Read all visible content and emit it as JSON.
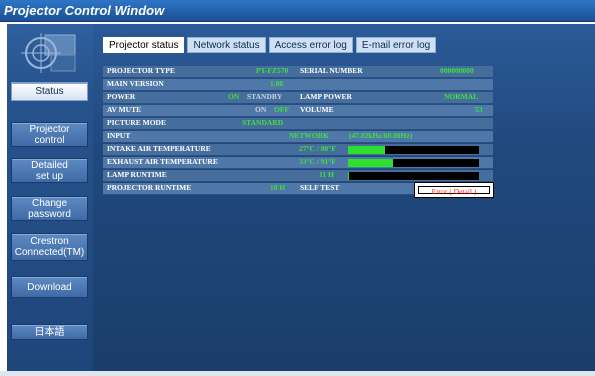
{
  "window": {
    "title": "Projector Control Window"
  },
  "nav": [
    {
      "label": "Status",
      "active": true
    },
    {
      "label": "Projector\ncontrol",
      "active": false
    },
    {
      "label": "Detailed\nset up",
      "active": false
    },
    {
      "label": "Change\npassword",
      "active": false
    },
    {
      "label": "Crestron\nConnected(TM)",
      "active": false
    },
    {
      "label": "Download",
      "active": false
    },
    {
      "label": "日本語",
      "active": false
    }
  ],
  "tabs": [
    {
      "label": "Projector status",
      "active": true
    },
    {
      "label": "Network status",
      "active": false
    },
    {
      "label": "Access error log",
      "active": false
    },
    {
      "label": "E-mail error log",
      "active": false
    }
  ],
  "status": {
    "projector_type_label": "PROJECTOR TYPE",
    "projector_type": "PT-FZ570",
    "serial_label": "SERIAL NUMBER",
    "serial": "000000000",
    "main_version_label": "MAIN VERSION",
    "main_version": "1.00",
    "power_label": "POWER",
    "power_on": "ON",
    "power_standby": "STANDBY",
    "lamp_power_label": "LAMP POWER",
    "lamp_power": "NORMAL",
    "av_mute_label": "AV MUTE",
    "av_mute_on": "ON",
    "av_mute_off": "OFF",
    "volume_label": "VOLUME",
    "volume": "53",
    "picture_mode_label": "PICTURE MODE",
    "picture_mode": "STANDARD",
    "input_label": "INPUT",
    "input": "NETWORK",
    "input_signal": "(47.82kHz/60.00Hz)",
    "intake_label": "INTAKE AIR TEMPERATURE",
    "intake": "27°C / 80°F",
    "intake_level": 0.28,
    "exhaust_label": "EXHAUST AIR TEMPERATURE",
    "exhaust": "33°C / 91°F",
    "exhaust_level": 0.34,
    "lamp_runtime_label": "LAMP RUNTIME",
    "lamp_runtime": "11 H",
    "lamp_runtime_level": 0.01,
    "projector_runtime_label": "PROJECTOR RUNTIME",
    "projector_runtime": "10 H",
    "self_test_label": "SELF TEST",
    "self_test": "Error ( Detail )"
  },
  "colors": {
    "value_green": "#3ee03e",
    "bar_green": "#2ee02e",
    "error_red": "#ff1a1a",
    "panel_blue": "#21497e"
  }
}
